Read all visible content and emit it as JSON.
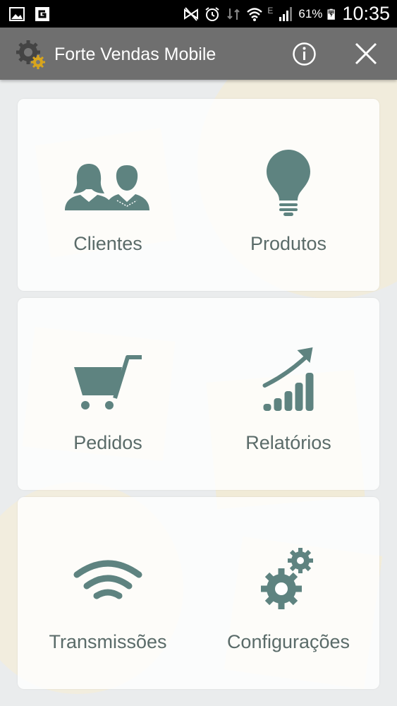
{
  "status_bar": {
    "battery_percent": "61%",
    "time": "10:35",
    "network_label": "E"
  },
  "app_bar": {
    "title": "Forte Vendas Mobile"
  },
  "menu": {
    "clientes": "Clientes",
    "produtos": "Produtos",
    "pedidos": "Pedidos",
    "relatorios": "Relatórios",
    "transmissoes": "Transmissões",
    "configuracoes": "Configurações"
  },
  "colors": {
    "icon": "#5e8380",
    "label": "#5a6b69",
    "action_bar": "#6f6f6f",
    "status_bar": "#000000"
  }
}
